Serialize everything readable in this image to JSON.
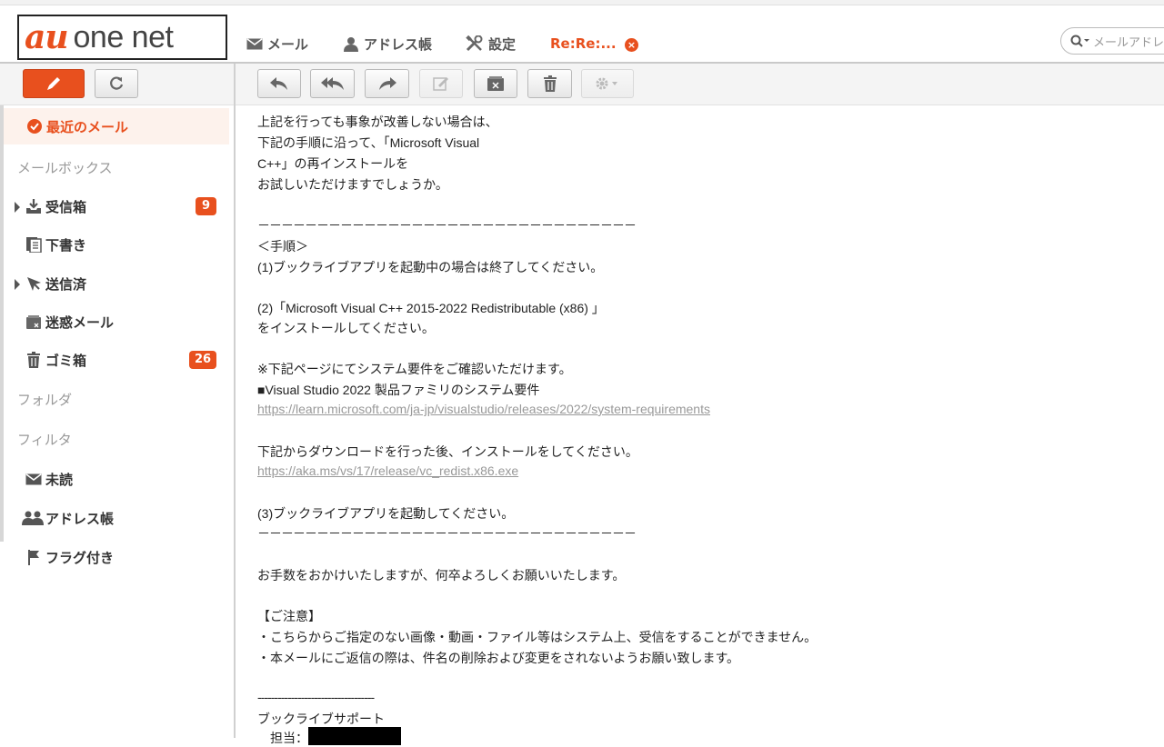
{
  "header": {
    "logo_au": "au",
    "logo_onenet": "one net",
    "tabs": [
      {
        "label": "メール",
        "icon": "envelope-icon"
      },
      {
        "label": "アドレス帳",
        "icon": "person-icon"
      },
      {
        "label": "設定",
        "icon": "tools-icon"
      }
    ],
    "active_tab": {
      "label": "Re:Re:...",
      "close_icon": "close-icon"
    },
    "search_placeholder": "メールアドレ",
    "accent_color": "#e8501e"
  },
  "toolbar": {
    "left_buttons": [
      {
        "name": "compose-button",
        "icon": "pencil-icon"
      },
      {
        "name": "refresh-button",
        "icon": "refresh-icon"
      }
    ],
    "right_buttons": [
      {
        "name": "reply-button",
        "icon": "reply-icon"
      },
      {
        "name": "reply-all-button",
        "icon": "reply-all-icon"
      },
      {
        "name": "forward-button",
        "icon": "forward-icon"
      },
      {
        "name": "edit-button",
        "icon": "edit-icon",
        "disabled": true
      },
      {
        "name": "spam-button",
        "icon": "spam-icon"
      },
      {
        "name": "trash-button",
        "icon": "trash-icon"
      },
      {
        "name": "settings-button",
        "icon": "gear-icon",
        "disabled": true
      }
    ]
  },
  "sidebar": {
    "recent": "最近のメール",
    "mailbox_section": "メールボックス",
    "items": [
      {
        "label": "受信箱",
        "icon": "inbox-icon",
        "count": "9"
      },
      {
        "label": "下書き",
        "icon": "draft-icon"
      },
      {
        "label": "送信済",
        "icon": "sent-icon"
      },
      {
        "label": "迷惑メール",
        "icon": "spam-icon"
      },
      {
        "label": "ゴミ箱",
        "icon": "trash-icon",
        "count": "26"
      }
    ],
    "folder_section": "フォルダ",
    "filter_section": "フィルタ",
    "filters": [
      {
        "label": "未読",
        "icon": "envelope-icon"
      },
      {
        "label": "アドレス帳",
        "icon": "people-icon"
      },
      {
        "label": "フラグ付き",
        "icon": "flag-icon"
      }
    ]
  },
  "message": {
    "lines": [
      "上記を行っても事象が改善しない場合は、",
      "下記の手順に沿って、「Microsoft Visual",
      "C++」の再インストールを",
      "お試しいただけますでしょうか。",
      "－－－－－－－－－－－－－－－－－－－－－－－－－－－－－－－－",
      "＜手順＞",
      "(1)ブックライブアプリを起動中の場合は終了してください。",
      "(2)「Microsoft Visual C++ 2015-2022 Redistributable (x86) 」",
      "をインストールしてください。",
      "※下記ページにてシステム要件をご確認いただけます。",
      "■Visual Studio 2022 製品ファミリのシステム要件",
      "https://learn.microsoft.com/ja-jp/visualstudio/releases/2022/system-requirements",
      "下記からダウンロードを行った後、インストールをしてください。",
      "https://aka.ms/vs/17/release/vc_redist.x86.exe",
      "(3)ブックライブアプリを起動してください。",
      "－－－－－－－－－－－－－－－－－－－－－－－－－－－－－－－－",
      "お手数をおかけいたしますが、何卒よろしくお願いいたします。",
      "【ご注意】",
      "・こちらからご指定のない画像・動画・ファイル等はシステム上、受信をすることができません。",
      "・本メールにご返信の際は、件名の削除および変更をされないようお願い致します。",
      "-----------------------------------",
      "ブックライブサポート",
      "　担当："
    ]
  }
}
